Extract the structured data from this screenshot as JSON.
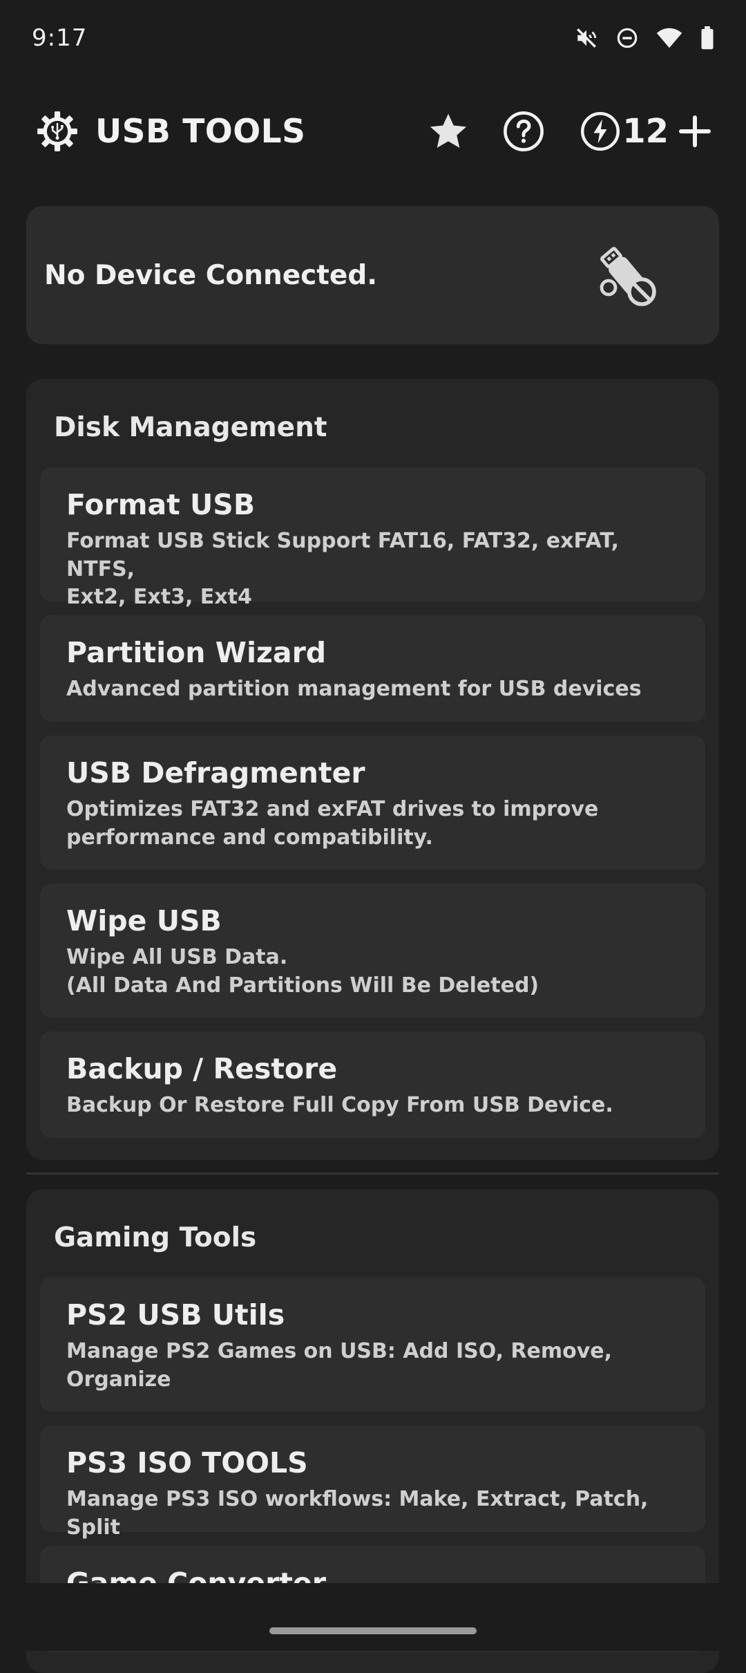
{
  "status_bar": {
    "time": "9:17",
    "icons": [
      "mute-icon",
      "dnd-icon",
      "wifi-icon",
      "battery-icon"
    ]
  },
  "header": {
    "title": "USB TOOLS",
    "credits": "12",
    "icons": [
      "usb-gear-logo-icon",
      "star-icon",
      "help-icon",
      "bolt-icon",
      "plus-icon"
    ]
  },
  "device": {
    "status": "No Device Connected.",
    "icon": "usb-disconnected-icon"
  },
  "disk_management": {
    "title": "Disk Management",
    "tools": [
      {
        "title": "Format USB",
        "desc": "Format USB Stick Support FAT16, FAT32, exFAT, NTFS,\nExt2, Ext3, Ext4"
      },
      {
        "title": "Partition Wizard",
        "desc": "Advanced partition management for USB devices"
      },
      {
        "title": "USB Defragmenter",
        "desc": "Optimizes FAT32 and exFAT drives to improve\nperformance and compatibility."
      },
      {
        "title": "Wipe USB",
        "desc": "Wipe All USB Data.\n(All Data And Partitions Will Be Deleted)"
      },
      {
        "title": "Backup / Restore",
        "desc": "Backup Or Restore Full Copy From USB Device."
      }
    ]
  },
  "gaming_tools": {
    "title": "Gaming Tools",
    "tools": [
      {
        "title": "PS2 USB Utils",
        "desc": "Manage PS2 Games on USB: Add ISO, Remove,\nOrganize"
      },
      {
        "title": "PS3 ISO TOOLS",
        "desc": "Manage PS3 ISO workflows: Make, Extract, Patch, Split"
      },
      {
        "title": "Game Converter",
        "desc": ""
      }
    ]
  },
  "colors": {
    "background": "#1c1c1c",
    "card": "#2c2c2c",
    "section": "#262626",
    "tool_card": "#2e2e2e",
    "text": "#eeeeee"
  }
}
